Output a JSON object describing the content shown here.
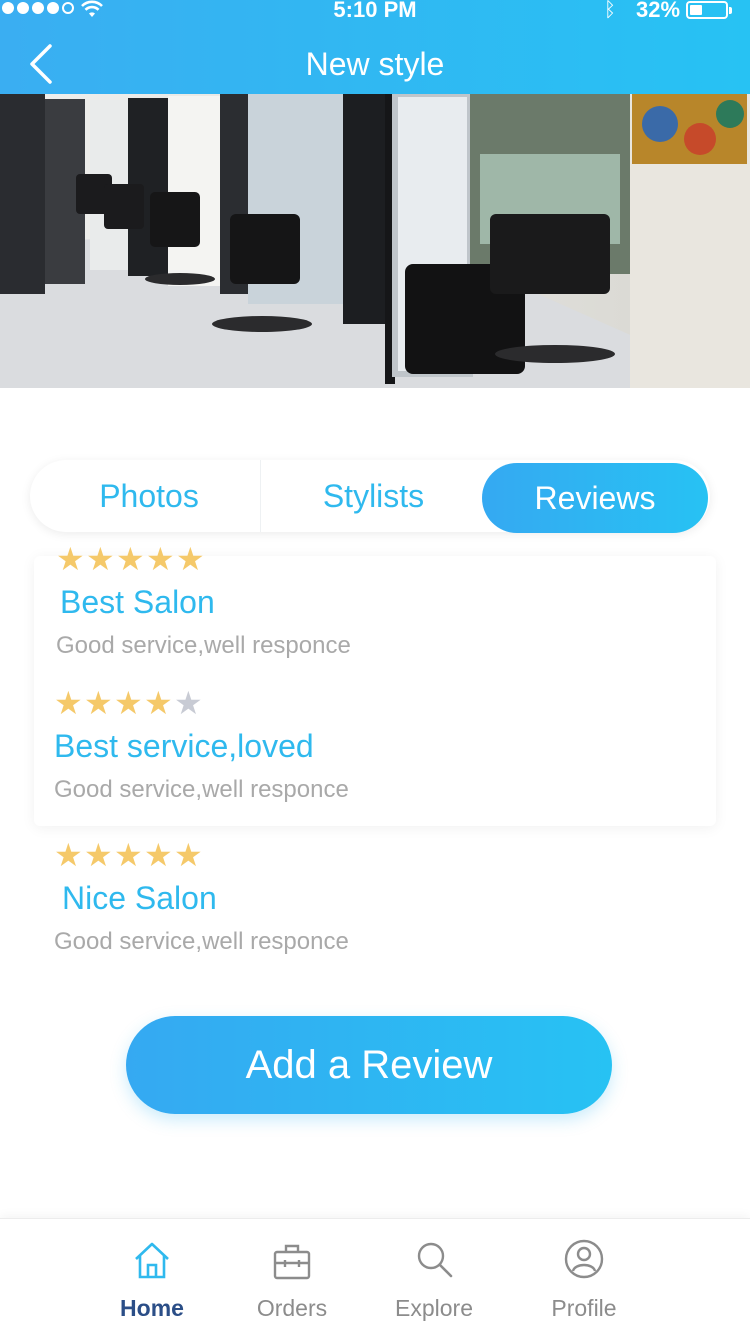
{
  "status_bar": {
    "time": "5:10 PM",
    "battery": "32%"
  },
  "header": {
    "title": "New style",
    "back_icon": "chevron-left-icon"
  },
  "tabs": [
    {
      "label": "Photos",
      "active": false
    },
    {
      "label": "Stylists",
      "active": false
    },
    {
      "label": "Reviews",
      "active": true
    }
  ],
  "reviews": [
    {
      "rating": 5,
      "title": "Best Salon",
      "text": "Good service,well responce"
    },
    {
      "rating": 4,
      "title": "Best service,loved",
      "text": "Good service,well responce"
    },
    {
      "rating": 5,
      "title": "Nice Salon",
      "text": "Good service,well responce"
    }
  ],
  "add_review_label": "Add a Review",
  "bottom_nav": [
    {
      "label": "Home",
      "icon": "home-icon",
      "active": true
    },
    {
      "label": "Orders",
      "icon": "briefcase-icon",
      "active": false
    },
    {
      "label": "Explore",
      "icon": "search-icon",
      "active": false
    },
    {
      "label": "Profile",
      "icon": "user-icon",
      "active": false
    }
  ],
  "colors": {
    "accent": "#2fb9ee",
    "star": "#f5c96a",
    "nav_active": "#2b4e87"
  }
}
